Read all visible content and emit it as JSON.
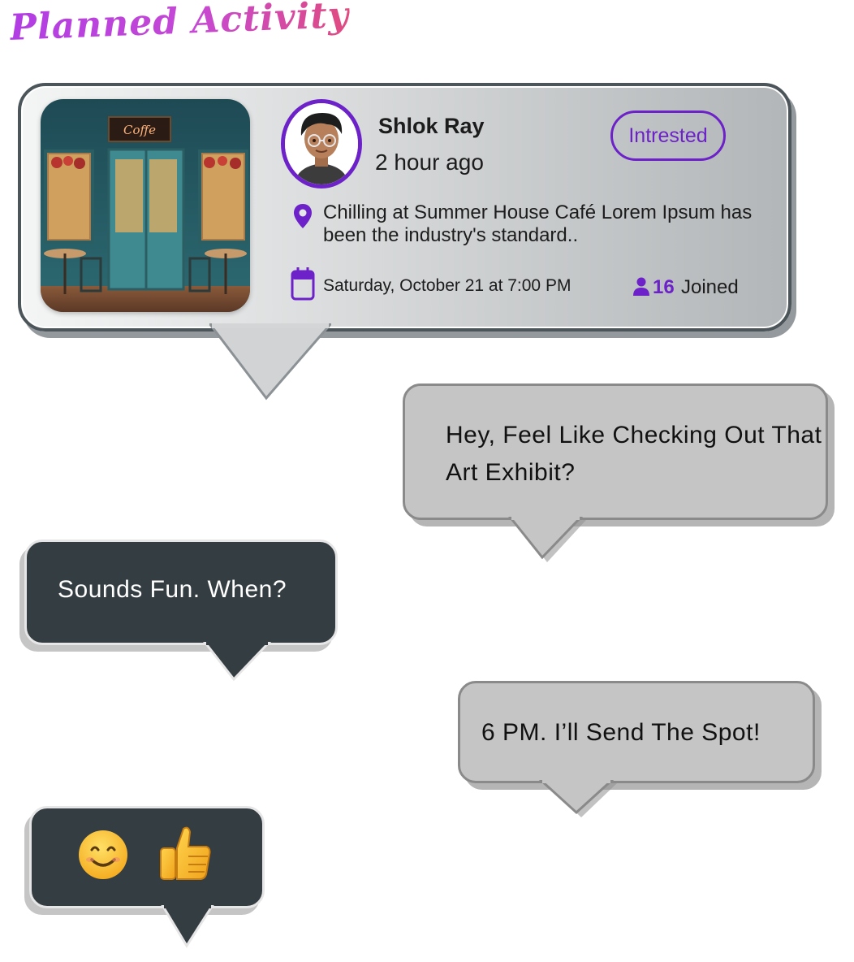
{
  "header": {
    "title": "Planned Activity"
  },
  "activity_card": {
    "user_name": "Shlok Ray",
    "posted_time": "2 hour ago",
    "interest_button_label": "Intrested",
    "description": "Chilling at Summer House Café Lorem Ipsum has been the industry's standard..",
    "event_datetime": "Saturday, October 21 at 7:00 PM",
    "joined_count": "16",
    "joined_label": "Joined",
    "image_sign_text": "Coffe"
  },
  "messages": [
    {
      "text": "Hey, Feel Like Checking Out That Art Exhibit?",
      "side": "right"
    },
    {
      "text": "Sounds Fun. When?",
      "side": "left"
    },
    {
      "text": "6 PM. I’ll Send The Spot!",
      "side": "right"
    },
    {
      "text": "",
      "side": "left",
      "icons": [
        "smiling-face-emoji",
        "thumbs-up-emoji"
      ]
    }
  ],
  "colors": {
    "accent": "#6c22c8",
    "title_gradient_start": "#b13de4",
    "title_gradient_end": "#e04b7f",
    "dark_bubble": "#343d42",
    "light_bubble": "#c5c5c5"
  }
}
